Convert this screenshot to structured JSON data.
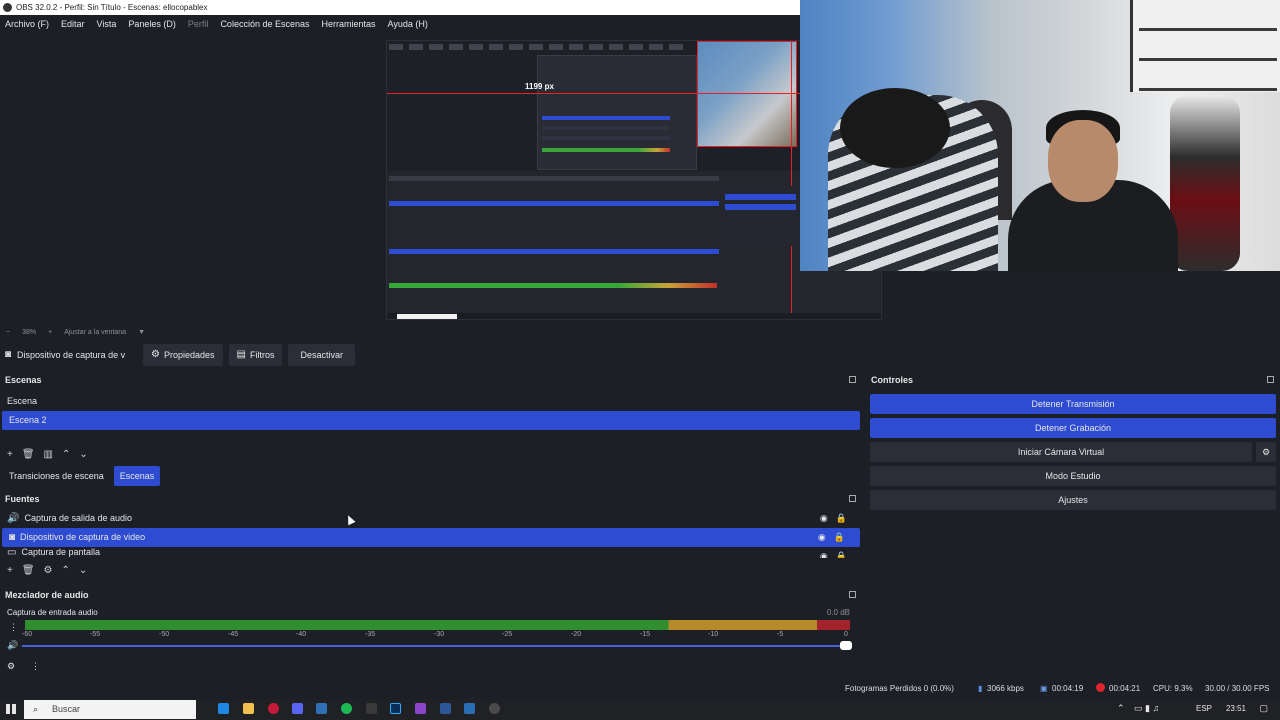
{
  "window": {
    "title": "OBS 32.0.2 - Perfil: Sin Título - Escenas: ellocopablex"
  },
  "menu": {
    "items": [
      "Archivo (F)",
      "Editar",
      "Vista",
      "Paneles (D)",
      "Perfil",
      "Colección de Escenas",
      "Herramientas",
      "Ayuda (H)"
    ]
  },
  "preview": {
    "canvas_label": "1199 px",
    "zoom": "38%",
    "fit_label": "Ajustar a la ventana"
  },
  "context": {
    "source_name": "Dispositivo de captura de v",
    "properties": "Propiedades",
    "filters": "Filtros",
    "deactivate": "Desactivar"
  },
  "scenes": {
    "title": "Escenas",
    "items": [
      {
        "label": "Escena",
        "selected": false
      },
      {
        "label": "Escena 2",
        "selected": true
      }
    ],
    "tabs": {
      "transitions": "Transiciones de escena",
      "scenes": "Escenas"
    }
  },
  "sources": {
    "title": "Fuentes",
    "items": [
      {
        "label": "Captura de salida de audio",
        "icon": "speaker-icon",
        "selected": false
      },
      {
        "label": "Dispositivo de captura de video",
        "icon": "camera-icon",
        "selected": true
      },
      {
        "label": "Captura de pantalla",
        "icon": "monitor-icon",
        "selected": false
      }
    ]
  },
  "mixer": {
    "title": "Mezclador de audio",
    "channel": "Captura de entrada audio",
    "level": "0.0 dB",
    "ticks": [
      "-60",
      "-55",
      "-50",
      "-45",
      "-40",
      "-35",
      "-30",
      "-25",
      "-20",
      "-15",
      "-10",
      "-5",
      "0"
    ]
  },
  "controls": {
    "title": "Controles",
    "stop_stream": "Detener Transmisión",
    "stop_record": "Detener Grabación",
    "virtual_cam": "Iniciar Cámara Virtual",
    "studio_mode": "Modo Estudio",
    "settings": "Ajustes"
  },
  "status": {
    "dropped": "Fotogramas Perdidos 0 (0.0%)",
    "bitrate": "3066 kbps",
    "stream_time": "00:04:19",
    "record_time": "00:04:21",
    "cpu": "CPU: 9.3%",
    "fps": "30.00 / 30.00 FPS"
  },
  "taskbar": {
    "search_placeholder": "Buscar",
    "lang": "ESP",
    "time": "23:51"
  },
  "colors": {
    "accent": "#2d4cd1",
    "background": "#1d1f26",
    "button": "#2b2e38",
    "record": "#e0262b"
  }
}
